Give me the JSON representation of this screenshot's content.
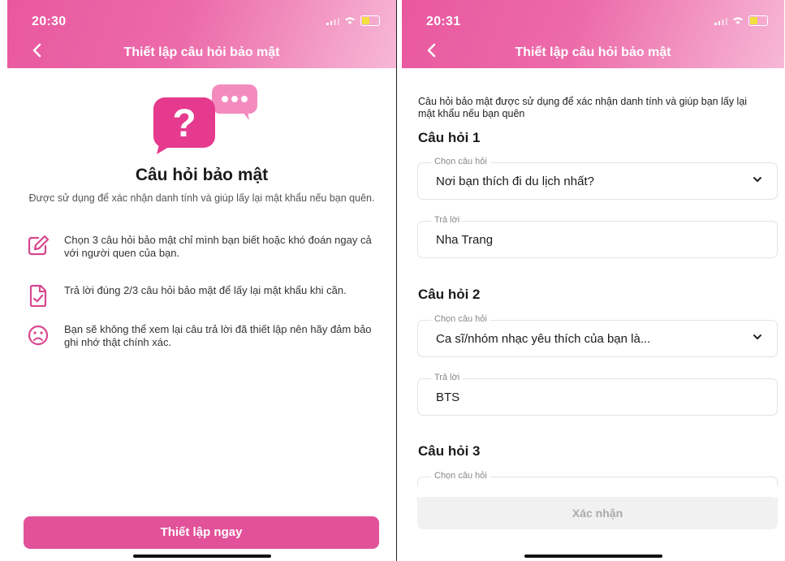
{
  "left": {
    "status_time": "20:30",
    "nav_title": "Thiết lập câu hỏi bảo mật",
    "intro_title": "Câu hỏi bảo mật",
    "intro_desc": "Được sử dụng để xác nhận danh tính và giúp lấy lại mật khẩu nếu bạn quên.",
    "tips": [
      {
        "icon": "edit-icon",
        "text": "Chọn 3 câu hỏi bảo mật chỉ mình bạn biết hoặc khó đoán ngay cả với người quen của bạn."
      },
      {
        "icon": "document-check-icon",
        "text": "Trả lời đúng 2/3 câu hỏi bảo mật để lấy lại mật khẩu khi cần."
      },
      {
        "icon": "sad-face-icon",
        "text": "Bạn sẽ không thể xem lại câu trả lời đã thiết lập nên hãy đảm bảo ghi nhớ thật chính xác."
      }
    ],
    "primary_button": "Thiết lập ngay"
  },
  "right": {
    "status_time": "20:31",
    "nav_title": "Thiết lập câu hỏi bảo mật",
    "intro": "Câu hỏi bảo mật được sử dụng để xác nhận danh tính và giúp bạn lấy lại mật khẩu nếu bạn quên",
    "questions": [
      {
        "title": "Câu hỏi 1",
        "select_label": "Chọn câu hỏi",
        "select_value": "Nơi bạn thích đi du lịch nhất?",
        "answer_label": "Trả lời",
        "answer_value": "Nha Trang"
      },
      {
        "title": "Câu hỏi 2",
        "select_label": "Chọn câu hỏi",
        "select_value": "Ca sĩ/nhóm nhạc yêu thích của bạn là...",
        "answer_label": "Trả lời",
        "answer_value": "BTS"
      },
      {
        "title": "Câu hỏi 3",
        "select_label": "Chọn câu hỏi"
      }
    ],
    "confirm_button": "Xác nhận"
  },
  "colors": {
    "brand_pink": "#e2529a",
    "header_gradient_start": "#e9589f",
    "header_gradient_end": "#f7b8d6",
    "disabled_button": "#f1f1f1"
  }
}
